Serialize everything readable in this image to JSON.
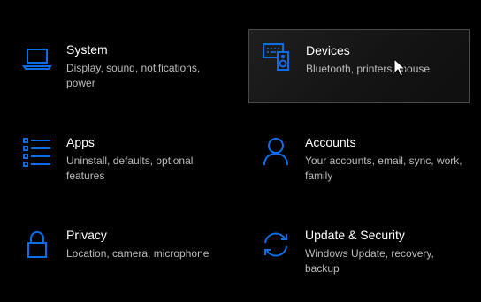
{
  "accent_color": "#0a6ee8",
  "tiles": [
    {
      "icon": "laptop-icon",
      "title": "System",
      "description": "Display, sound, notifications, power"
    },
    {
      "icon": "devices-icon",
      "title": "Devices",
      "description": "Bluetooth, printers, mouse"
    },
    {
      "icon": "apps-icon",
      "title": "Apps",
      "description": "Uninstall, defaults, optional features"
    },
    {
      "icon": "person-icon",
      "title": "Accounts",
      "description": "Your accounts, email, sync, work, family"
    },
    {
      "icon": "lock-icon",
      "title": "Privacy",
      "description": "Location, camera, microphone"
    },
    {
      "icon": "sync-icon",
      "title": "Update & Security",
      "description": "Windows Update, recovery, backup"
    }
  ]
}
